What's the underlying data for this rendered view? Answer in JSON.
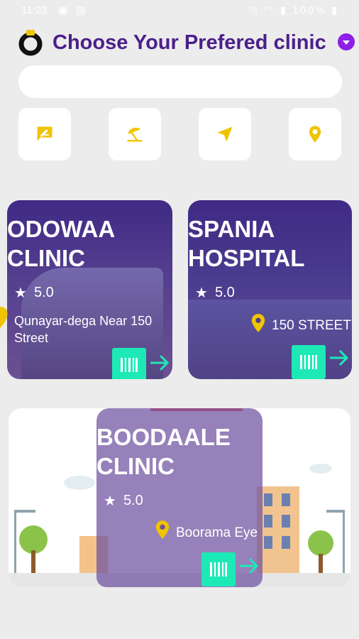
{
  "statusbar": {
    "time": "11:23",
    "battery": "100%"
  },
  "header": {
    "title": "Choose Your Prefered clinic"
  },
  "search": {
    "placeholder": ""
  },
  "quick_actions": [
    {
      "icon": "message-edit-icon"
    },
    {
      "icon": "beach-umbrella-icon"
    },
    {
      "icon": "navigation-arrow-icon"
    },
    {
      "icon": "location-pin-icon"
    }
  ],
  "clinics": [
    {
      "name_line1": "ODOWAA",
      "name_line2": "CLINIC",
      "rating": "5.0",
      "address_line1": "Qunayar-dega Near 150",
      "address_line2": "Street"
    },
    {
      "name_line1": "SPANIA",
      "name_line2": "HOSPITAL",
      "rating": "5.0",
      "address_line1": "150 STREET",
      "address_line2": ""
    },
    {
      "name_line1": "BOODAALE",
      "name_line2": "CLINIC",
      "rating": "5.0",
      "address_line1": "Boorama Eye",
      "address_line2": ""
    }
  ],
  "colors": {
    "accent": "#4b1f8a",
    "brand_yellow": "#f0c400",
    "badge_green": "#1de9b6",
    "dropdown_purple": "#8e1fe6"
  }
}
